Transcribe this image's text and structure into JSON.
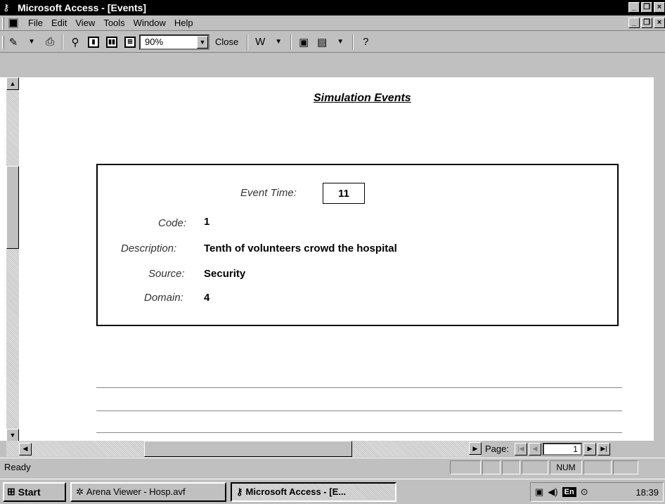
{
  "window": {
    "title": "Microsoft Access - [Events]",
    "app_icon": "key-icon",
    "buttons": [
      "_",
      "Ή",
      "×"
    ]
  },
  "menubar": {
    "items": [
      "File",
      "Edit",
      "View",
      "Tools",
      "Window",
      "Help"
    ]
  },
  "toolbar": {
    "zoom_value": "90%",
    "close_label": "Close",
    "icons": [
      "view-design-icon",
      "print-icon",
      "zoom-icon",
      "one-page-icon",
      "two-pages-icon",
      "multiple-pages-icon",
      "office-links-icon",
      "database-window-icon",
      "new-object-icon",
      "help-icon"
    ]
  },
  "report": {
    "title": "Simulation Events",
    "event_time_label": "Event Time:",
    "event_time_value": "11",
    "code_label": "Code:",
    "code_value": "1",
    "description_label": "Description:",
    "description_value": "Tenth of volunteers crowd the hospital",
    "source_label": "Source:",
    "source_value": "Security",
    "domain_label": "Domain:",
    "domain_value": "4"
  },
  "navigation": {
    "page_label": "Page:",
    "page_value": "1"
  },
  "status": {
    "text": "Ready",
    "num_indicator": "NUM"
  },
  "taskbar": {
    "start_label": "Start",
    "tasks": [
      "Arena Viewer - Hosp.avf",
      "Microsoft Access - [E..."
    ],
    "tray_lang": "En",
    "clock": "18:39"
  }
}
